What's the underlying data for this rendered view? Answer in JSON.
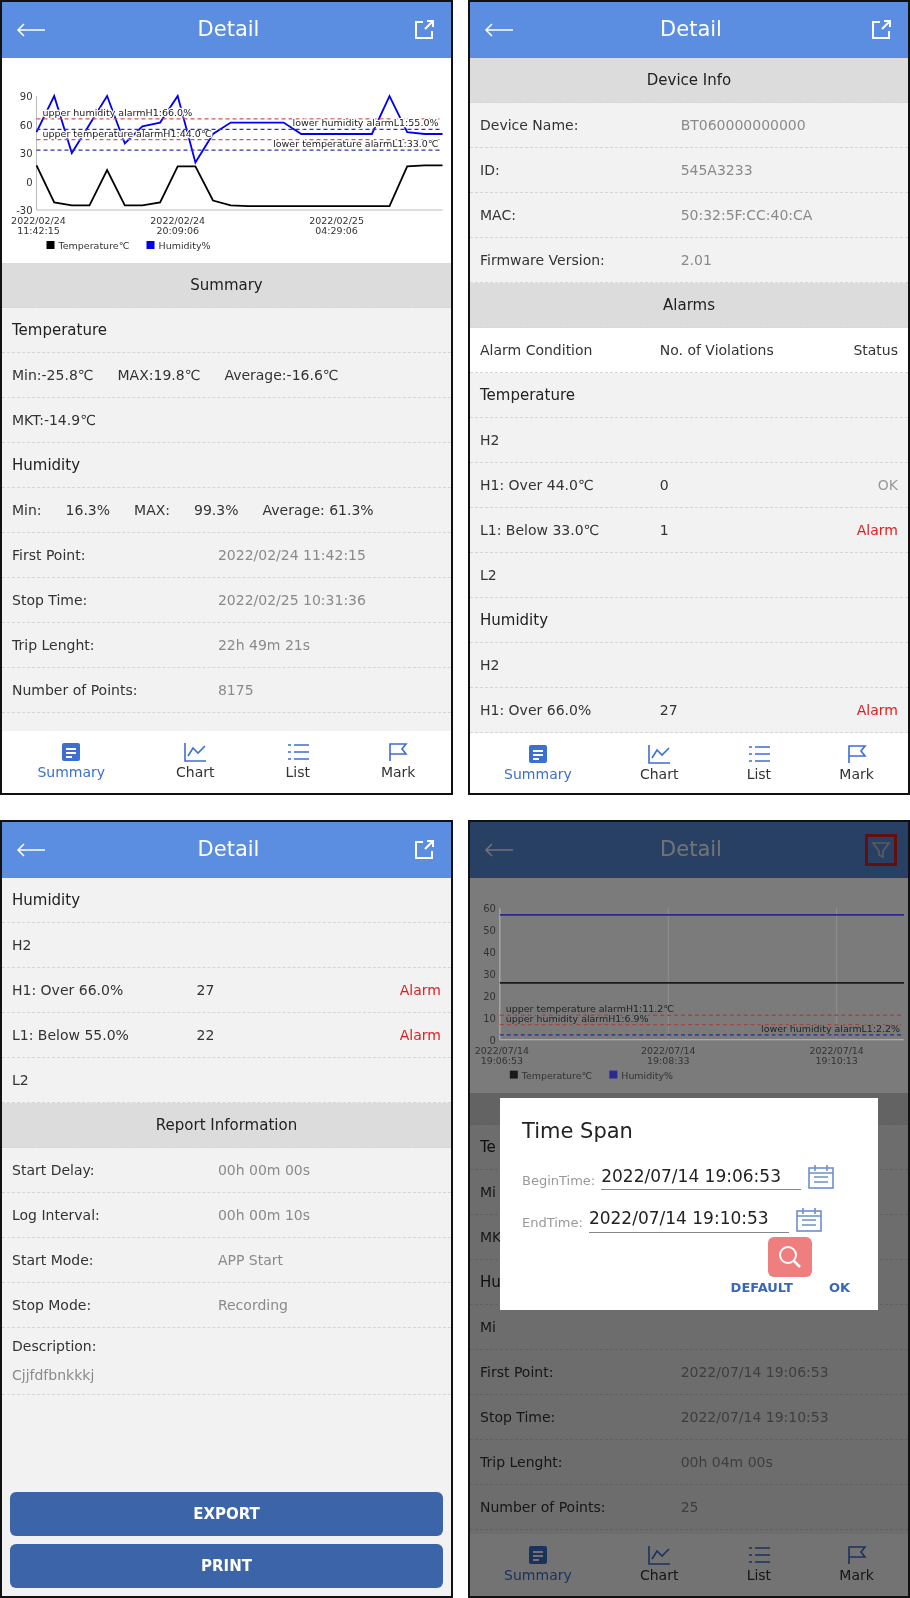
{
  "panels": [
    {
      "header": {
        "title": "Detail",
        "kind": "share",
        "highlighted": false
      },
      "chart": {
        "chart_data": {
          "type": "line",
          "categories": [
            "2022/02/24 11:42:15",
            null,
            null,
            null,
            null,
            null,
            null,
            null,
            "2022/02/24 20:09:06",
            null,
            null,
            null,
            null,
            null,
            null,
            null,
            null,
            "2022/02/25 04:29:06",
            null,
            null,
            null,
            null,
            null,
            null
          ],
          "ylim": [
            -30,
            90
          ],
          "yticks": [
            90,
            60,
            30,
            0,
            -30
          ],
          "series": [
            {
              "name": "Temperature℃",
              "color": "#000000",
              "values": [
                17,
                -22,
                -25,
                -25,
                12,
                -25,
                -25,
                -22,
                16,
                16,
                -20,
                -25,
                -26,
                -26,
                -26,
                -26,
                -26,
                -26,
                -26,
                -26,
                -26,
                16,
                17,
                17
              ]
            },
            {
              "name": "Humidity%",
              "color": "#0000ee",
              "values": [
                52,
                90,
                30,
                60,
                90,
                40,
                58,
                62,
                90,
                20,
                50,
                62,
                62,
                62,
                62,
                50,
                50,
                50,
                50,
                50,
                90,
                52,
                50,
                50
              ]
            }
          ],
          "legend": "bottom",
          "ref_lines": [
            {
              "axis": "y",
              "value": 66,
              "label": "upper humidity alarmH1:66.0%",
              "color": "#e05050"
            },
            {
              "axis": "y",
              "value": 44,
              "label": "upper temperature alarmH1:44.0℃",
              "color": "#e05050"
            },
            {
              "axis": "y",
              "value": 55,
              "label": "lower humidity alarmL1:55.0%",
              "color": "#3030b0"
            },
            {
              "axis": "y",
              "value": 33,
              "label": "lower temperature alarmL1:33.0℃",
              "color": "#3030b0"
            }
          ]
        }
      },
      "rows": [
        {
          "kind": "section",
          "text": "Summary"
        },
        {
          "kind": "group",
          "text": "Temperature"
        },
        {
          "kind": "cells",
          "cells": [
            "Min:-25.8℃",
            "MAX:19.8℃",
            "Average:-16.6℃"
          ]
        },
        {
          "kind": "text",
          "text": "MKT:-14.9℃"
        },
        {
          "kind": "group",
          "text": "Humidity"
        },
        {
          "kind": "cells",
          "cells": [
            "Min:",
            "16.3%",
            "MAX:",
            "99.3%",
            "Average: 61.3%"
          ]
        },
        {
          "kind": "pair",
          "label": "First Point:",
          "value": "2022/02/24 11:42:15"
        },
        {
          "kind": "pair",
          "label": "Stop Time:",
          "value": "2022/02/25 10:31:36"
        },
        {
          "kind": "pair",
          "label": "Trip Lenght:",
          "value": "22h 49m 21s"
        },
        {
          "kind": "pair",
          "label": "Number of Points:",
          "value": "8175"
        }
      ],
      "tabs": [
        {
          "label": "Summary",
          "selected": true
        },
        {
          "label": "Chart",
          "selected": false
        },
        {
          "label": "List",
          "selected": false
        },
        {
          "label": "Mark",
          "selected": false
        }
      ]
    },
    {
      "header": {
        "title": "Detail",
        "kind": "share",
        "highlighted": false
      },
      "rows": [
        {
          "kind": "section",
          "text": "Device Info"
        },
        {
          "kind": "pair",
          "label": "Device Name:",
          "value": "BT060000000000"
        },
        {
          "kind": "pair",
          "label": "ID:",
          "value": "545A3233"
        },
        {
          "kind": "pair",
          "label": "MAC:",
          "value": "50:32:5F:CC:40:CA"
        },
        {
          "kind": "pair",
          "label": "Firmware Version:",
          "value": "2.01"
        },
        {
          "kind": "section",
          "text": "Alarms"
        },
        {
          "kind": "columns",
          "cells": [
            "Alarm Condition",
            "No. of Violations",
            "Status"
          ]
        },
        {
          "kind": "group",
          "text": "Temperature"
        },
        {
          "kind": "text",
          "text": "H2"
        },
        {
          "kind": "alarm",
          "condition": "H1: Over 44.0℃",
          "count": "0",
          "status": "OK",
          "alarm": false
        },
        {
          "kind": "alarm",
          "condition": "L1: Below 33.0℃",
          "count": "1",
          "status": "Alarm",
          "alarm": true
        },
        {
          "kind": "text",
          "text": "L2"
        },
        {
          "kind": "group",
          "text": "Humidity"
        },
        {
          "kind": "text",
          "text": "H2"
        },
        {
          "kind": "alarm",
          "condition": "H1: Over 66.0%",
          "count": "27",
          "status": "Alarm",
          "alarm": true
        }
      ],
      "tabs": [
        {
          "label": "Summary",
          "selected": true
        },
        {
          "label": "Chart",
          "selected": false
        },
        {
          "label": "List",
          "selected": false
        },
        {
          "label": "Mark",
          "selected": false
        }
      ]
    },
    {
      "header": {
        "title": "Detail",
        "kind": "share",
        "highlighted": false
      },
      "rows": [
        {
          "kind": "group",
          "text": "Humidity"
        },
        {
          "kind": "text",
          "text": "H2"
        },
        {
          "kind": "alarm",
          "condition": "H1: Over 66.0%",
          "count": "27",
          "status": "Alarm",
          "alarm": true
        },
        {
          "kind": "alarm",
          "condition": "L1: Below 55.0%",
          "count": "22",
          "status": "Alarm",
          "alarm": true
        },
        {
          "kind": "text",
          "text": "L2"
        },
        {
          "kind": "section",
          "text": "Report Information"
        },
        {
          "kind": "pair",
          "label": "Start Delay:",
          "value": "00h 00m 00s"
        },
        {
          "kind": "pair",
          "label": "Log Interval:",
          "value": "00h 00m 10s"
        },
        {
          "kind": "pair",
          "label": "Start Mode:",
          "value": "APP Start"
        },
        {
          "kind": "pair",
          "label": "Stop Mode:",
          "value": "Recording"
        },
        {
          "kind": "desc",
          "label": "Description:",
          "value": "Cjjfdfbnkkkj"
        }
      ],
      "buttons": [
        "EXPORT",
        "PRINT"
      ]
    },
    {
      "header": {
        "title": "Detail",
        "kind": "filter",
        "highlighted": true
      },
      "chart": {
        "chart_data": {
          "type": "line",
          "categories": [
            "2022/07/14 19:06:53",
            null,
            null,
            null,
            null,
            "2022/07/14 19:08:33",
            null,
            null,
            null,
            null,
            "2022/07/14 19:10:13",
            null,
            null
          ],
          "ylim": [
            0,
            60
          ],
          "yticks": [
            60,
            50,
            40,
            30,
            20,
            10,
            0
          ],
          "series": [
            {
              "name": "Temperature℃",
              "color": "#1a1a1a",
              "values": [
                26,
                26,
                26,
                26,
                26,
                26,
                26,
                26,
                26,
                26,
                26,
                26,
                26
              ]
            },
            {
              "name": "Humidity%",
              "color": "#2a2a90",
              "values": [
                57,
                57,
                57,
                57,
                57,
                57,
                57,
                57,
                57,
                57,
                57,
                57,
                57
              ]
            }
          ],
          "legend": "bottom",
          "ref_lines": [
            {
              "axis": "y",
              "value": 11.2,
              "label": "upper temperature alarmH1:11.2℃",
              "color": "#a04848"
            },
            {
              "axis": "y",
              "value": 6.9,
              "label": "upper humidity alarmH1:6.9%",
              "color": "#a04848"
            },
            {
              "axis": "y",
              "value": 2.2,
              "label": "lower humidity alarmL1:2.2%",
              "color": "#2a2a90"
            }
          ]
        }
      },
      "rows": [
        {
          "kind": "band"
        },
        {
          "kind": "group",
          "text": "Te"
        },
        {
          "kind": "text",
          "text": "Mi"
        },
        {
          "kind": "text",
          "text": "MK"
        },
        {
          "kind": "group",
          "text": "Hu"
        },
        {
          "kind": "text",
          "text": "Mi"
        },
        {
          "kind": "pair",
          "label": "First Point:",
          "value": "2022/07/14 19:06:53"
        },
        {
          "kind": "pair",
          "label": "Stop Time:",
          "value": "2022/07/14 19:10:53"
        },
        {
          "kind": "pair",
          "label": "Trip Lenght:",
          "value": "00h 04m 00s"
        },
        {
          "kind": "pair",
          "label": "Number of Points:",
          "value": "25"
        }
      ],
      "tabs": [
        {
          "label": "Summary",
          "selected": true
        },
        {
          "label": "Chart",
          "selected": false
        },
        {
          "label": "List",
          "selected": false
        },
        {
          "label": "Mark",
          "selected": false
        }
      ],
      "dialog": {
        "title": "Time Span",
        "fields": [
          {
            "label": "BeginTime:",
            "value": "2022/07/14 19:06:53"
          },
          {
            "label": "EndTime:",
            "value": "2022/07/14 19:10:53"
          }
        ],
        "buttons": [
          "DEFAULT",
          "OK"
        ]
      }
    }
  ]
}
